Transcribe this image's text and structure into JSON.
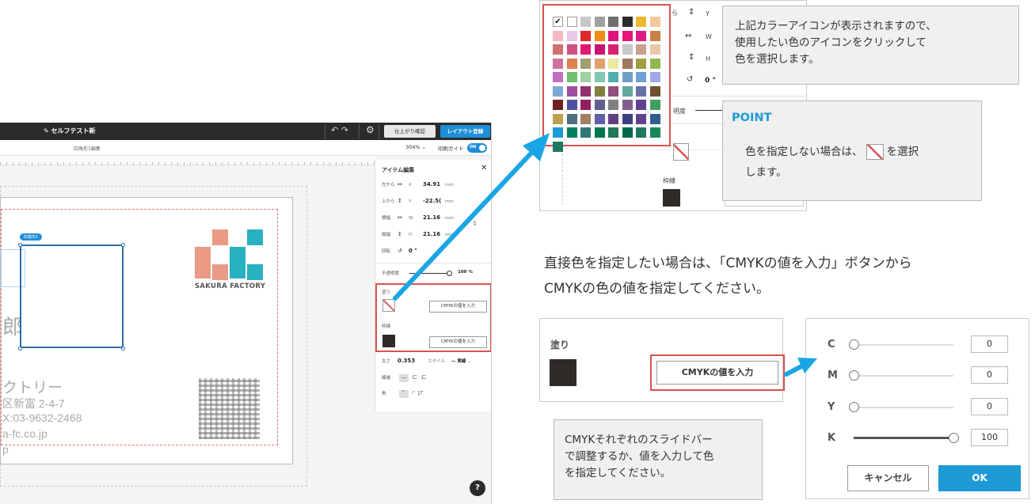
{
  "editor": {
    "title": "セルフテスト新",
    "check_button": "仕上がり確認",
    "layout_button": "レイアウト登録",
    "sub_label": "四角形1編集",
    "zoom": "304%",
    "print_guide_label": "印刷ガイド",
    "toggle": "ON",
    "selection_tag": "四角形1",
    "card_name_fragment": "郎",
    "card_company_fragment": "クトリー",
    "card_address": "区新富 2-4-7",
    "card_fax": "X:03-9632-2468",
    "card_url": "a-fc.co.jp",
    "card_url2": "p",
    "logo_text": "SAKURA FACTORY",
    "help": "?"
  },
  "item_panel": {
    "title": "アイテム編集",
    "close": "✕",
    "rows": [
      {
        "label": "左から",
        "axis": "X",
        "value": "34.91",
        "unit": "mm"
      },
      {
        "label": "上から",
        "axis": "Y",
        "value": "-22.5(",
        "unit": "mm"
      },
      {
        "label": "横幅",
        "axis": "W",
        "value": "21.16",
        "unit": "mm"
      },
      {
        "label": "縦幅",
        "axis": "H",
        "value": "21.16",
        "unit": "mm"
      }
    ],
    "rotate_label": "回転",
    "rotate_value": "0 °",
    "opacity_label": "不透明度",
    "opacity_value": "100 %",
    "fill_label": "塗り",
    "stroke_label": "枠線",
    "cmyk_button": "CMYKの値を入力",
    "thickness_label": "太さ",
    "thickness_value": "0.353",
    "style_label": "スタイル",
    "style_value": "— 実線",
    "line_label": "線端",
    "corner_label": "角"
  },
  "picker_crop": {
    "y_label": "Y",
    "w_label": "W",
    "h_label": "H",
    "rotate_value": "0 °",
    "opacity_fragment": "明度",
    "stroke_label": "枠線",
    "from_fragment": "ら"
  },
  "palette_colors": [
    "#ffffff",
    "#ffffff",
    "#c8c8c8",
    "#a0a0a0",
    "#6e6e6e",
    "#2b2b2b",
    "#f0b830",
    "#f4c79a",
    "#f4b8c0",
    "#e8c8e8",
    "#e02828",
    "#f08c14",
    "#e0147c",
    "#e8147c",
    "#e01884",
    "#c8824a",
    "#d07070",
    "#d05080",
    "#e01870",
    "#c81470",
    "#d82070",
    "#c8c8c8",
    "#c8a08c",
    "#e8c8a8",
    "#d070a0",
    "#e08050",
    "#a0a070",
    "#e0a070",
    "#e8e8a0",
    "#a07860",
    "#a0a040",
    "#90b850",
    "#c070c0",
    "#70c070",
    "#a0d0a0",
    "#80c8b0",
    "#50b0b0",
    "#70a0c8",
    "#70a0d8",
    "#a0a8e8",
    "#80a8d8",
    "#a050a0",
    "#903070",
    "#808040",
    "#905080",
    "#60a8a0",
    "#6870a8",
    "#705030",
    "#702020",
    "#5050a0",
    "#902060",
    "#606090",
    "#808080",
    "#806090",
    "#604090",
    "#40a060",
    "#c0a050",
    "#507080",
    "#a08060",
    "#6060a8",
    "#604080",
    "#404080",
    "#604090",
    "#306090",
    "#1e9ad6",
    "#008060",
    "#307878",
    "#007850",
    "#207858",
    "#006848",
    "#207860",
    "#188858",
    "#207860"
  ],
  "note1": {
    "lines": [
      "上記カラーアイコンが表示されますので、",
      "使用したい色のアイコンをクリックして",
      "色を選択します。"
    ]
  },
  "note2": {
    "point": "POINT",
    "text_before": "色を指定しない場合は、",
    "text_after": "を選択",
    "text_line2": "します。"
  },
  "direct": {
    "line1": "直接色を指定したい場合は、「CMYKの値を入力」ボタンから",
    "line2": "CMYKの色の値を指定してください。"
  },
  "fill_crop": {
    "label": "塗り",
    "button": "CMYKの値を入力"
  },
  "cmyk_dialog": {
    "rows": [
      {
        "label": "C",
        "value": "0",
        "level": 0
      },
      {
        "label": "M",
        "value": "0",
        "level": 0
      },
      {
        "label": "Y",
        "value": "0",
        "level": 0
      },
      {
        "label": "K",
        "value": "100",
        "level": 100
      }
    ],
    "cancel": "キャンセル",
    "ok": "OK"
  },
  "note3": {
    "lines": [
      "CMYKそれぞれのスライドバー",
      "で調整するか、値を入力して色",
      "を指定してください。"
    ]
  },
  "colors": {
    "accent_blue": "#1e9ad6",
    "highlight_red": "#d9534f",
    "logo_salmon": "#eb9a86",
    "logo_teal": "#27b1c1",
    "arrow_blue": "#1aa6e4"
  }
}
